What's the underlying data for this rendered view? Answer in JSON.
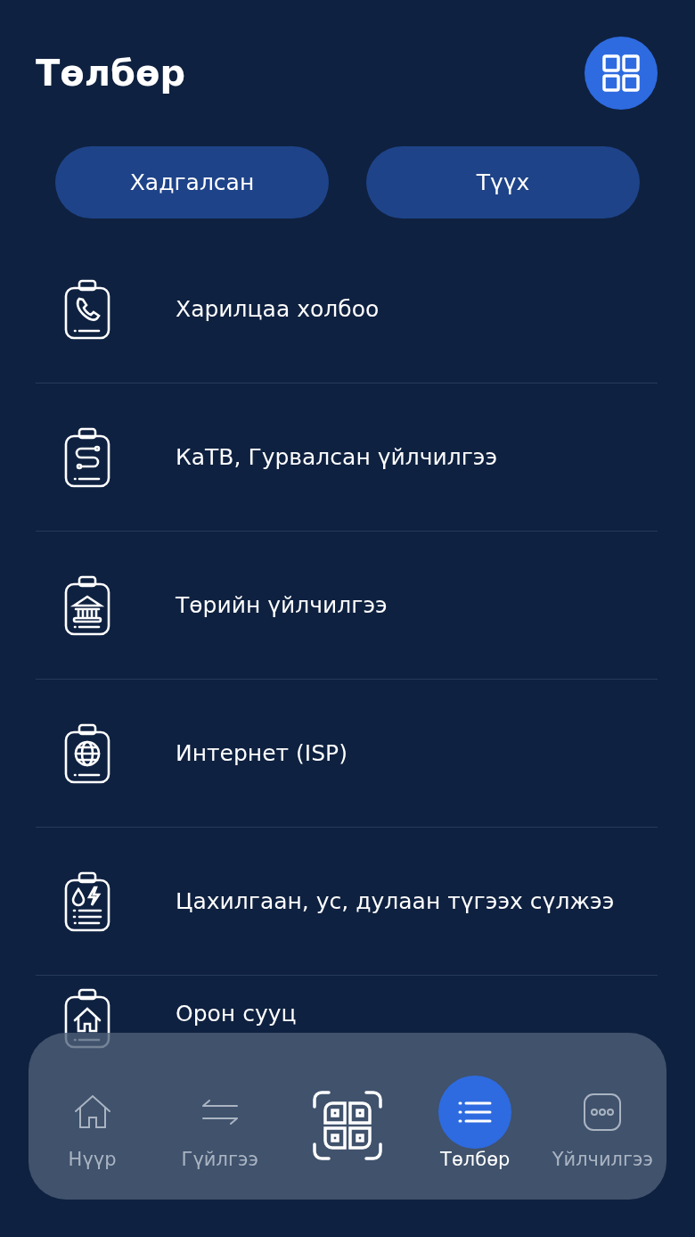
{
  "header": {
    "title": "Төлбөр"
  },
  "buttons": [
    {
      "label": "Хадгалсан"
    },
    {
      "label": "Түүх"
    }
  ],
  "categories": [
    {
      "label": "Харилцаа холбоо"
    },
    {
      "label": "КаТВ, Гурвалсан үйлчилгээ"
    },
    {
      "label": "Төрийн үйлчилгээ"
    },
    {
      "label": "Интернет (ISP)"
    },
    {
      "label": "Цахилгаан, ус, дулаан түгээх сүлжээ"
    },
    {
      "label": "Орон сууц"
    }
  ],
  "bottom_nav": [
    {
      "kind": "tab",
      "label": "Нүүр",
      "selected": false
    },
    {
      "kind": "tab",
      "label": "Гүйлгээ",
      "selected": false
    },
    {
      "kind": "scan"
    },
    {
      "kind": "tab",
      "label": "Төлбөр",
      "selected": true
    },
    {
      "kind": "tab",
      "label": "Үйлчилгээ",
      "selected": false
    }
  ]
}
